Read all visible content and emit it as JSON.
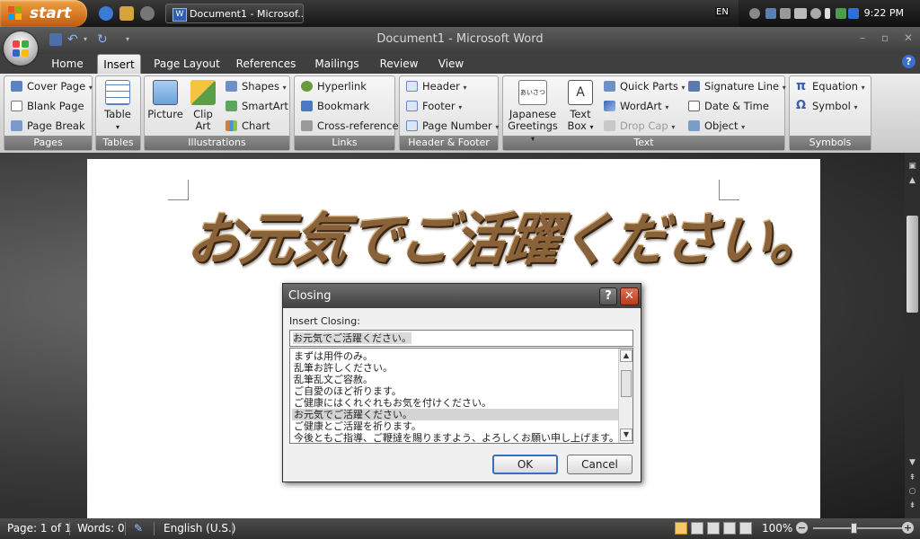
{
  "taskbar": {
    "start_label": "start",
    "task_item": "Document1 - Microsof...",
    "language": "EN",
    "clock": "9:22 PM"
  },
  "window": {
    "title": "Document1 - Microsoft Word"
  },
  "tabs": [
    "Home",
    "Insert",
    "Page Layout",
    "References",
    "Mailings",
    "Review",
    "View"
  ],
  "active_tab": "Insert",
  "ribbon": {
    "pages": {
      "name": "Pages",
      "cover_page": "Cover Page",
      "blank_page": "Blank Page",
      "page_break": "Page Break"
    },
    "tables": {
      "name": "Tables",
      "table": "Table"
    },
    "illustrations": {
      "name": "Illustrations",
      "picture": "Picture",
      "clip_art_1": "Clip",
      "clip_art_2": "Art",
      "shapes": "Shapes",
      "smartart": "SmartArt",
      "chart": "Chart"
    },
    "links": {
      "name": "Links",
      "hyperlink": "Hyperlink",
      "bookmark": "Bookmark",
      "cross_reference": "Cross-reference"
    },
    "header_footer": {
      "name": "Header & Footer",
      "header": "Header",
      "footer": "Footer",
      "page_number": "Page Number"
    },
    "text": {
      "name": "Text",
      "japanese_greetings_1": "Japanese",
      "japanese_greetings_2": "Greetings",
      "text_box_1": "Text",
      "text_box_2": "Box",
      "quick_parts": "Quick Parts",
      "wordart": "WordArt",
      "drop_cap": "Drop Cap",
      "signature_line": "Signature Line",
      "date_time": "Date & Time",
      "object": "Object",
      "jg_icon_text": "あいさつ"
    },
    "symbols": {
      "name": "Symbols",
      "equation": "Equation",
      "symbol": "Symbol"
    }
  },
  "document": {
    "wordart_text": "お元気でご活躍ください。"
  },
  "dialog": {
    "title": "Closing",
    "label": "Insert Closing:",
    "input_value": "お元気でご活躍ください。",
    "options": [
      "まずは用件のみ。",
      "乱筆お許しください。",
      "乱筆乱文ご容赦。",
      "ご自愛のほど祈ります。",
      "ご健康にはくれぐれもお気を付けください。",
      "お元気でご活躍ください。",
      "ご健康とご活躍を祈ります。",
      "今後ともご指導、ご鞭撻を賜りますよう、よろしくお願い申し上げます。"
    ],
    "selected_index": 5,
    "ok_label": "OK",
    "cancel_label": "Cancel"
  },
  "statusbar": {
    "page": "Page: 1 of 1",
    "words": "Words: 0",
    "language": "English (U.S.)",
    "zoom": "100%"
  },
  "colors": {
    "accent_blue": "#3c6fcf",
    "close_red": "#c9482a",
    "wordart_brown": "#8a6239"
  }
}
